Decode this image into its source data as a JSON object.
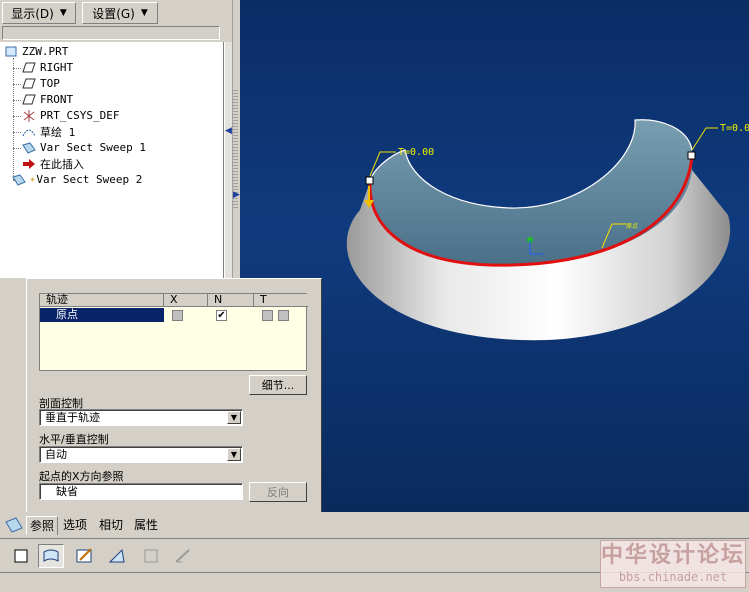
{
  "menus": {
    "display_label": "显示(D)",
    "settings_label": "设置(G)"
  },
  "tree": {
    "items": [
      {
        "label": "ZZW.PRT",
        "icon": "part-icon"
      },
      {
        "label": "RIGHT",
        "icon": "datum-plane-icon"
      },
      {
        "label": "TOP",
        "icon": "datum-plane-icon"
      },
      {
        "label": "FRONT",
        "icon": "datum-plane-icon"
      },
      {
        "label": "PRT_CSYS_DEF",
        "icon": "coordinate-system-icon"
      },
      {
        "label": "草绘 1",
        "icon": "sketch-icon"
      },
      {
        "label": "Var Sect Sweep 1",
        "icon": "sweep-icon"
      },
      {
        "label": "在此插入",
        "icon": "insert-here-arrow-icon"
      },
      {
        "label": "Var Sect Sweep 2",
        "icon": "sweep-icon"
      }
    ]
  },
  "viewport": {
    "label_t0_left": "T=0.00",
    "label_t0_right": "T=0.0",
    "label_origin": "原点",
    "colors": {
      "surface": "#9ab3c2",
      "trajectory": "#e01010",
      "background": "#0f3b7e"
    }
  },
  "dialog": {
    "table": {
      "headers": [
        "轨迹",
        "X",
        "N",
        "T"
      ],
      "rows": [
        {
          "name": "原点",
          "x": false,
          "n": true,
          "t": false
        }
      ]
    },
    "detail_button": "细节...",
    "section_control_label": "剖面控制",
    "section_control_value": "垂直于轨迹",
    "hv_control_label": "水平/垂直控制",
    "hv_control_value": "自动",
    "start_x_ref_label": "起点的X方向参照",
    "start_x_ref_value": "缺省",
    "reverse_button": "反向"
  },
  "tabs": [
    "参照",
    "选项",
    "相切",
    "属性"
  ],
  "toolbar": {
    "icons": [
      "solid-icon",
      "surface-icon",
      "edit-section-icon",
      "thicken-icon",
      "cut-icon",
      "thin-icon"
    ]
  },
  "watermark": {
    "title": "中华设计论坛",
    "url": "bbs.chinade.net"
  }
}
